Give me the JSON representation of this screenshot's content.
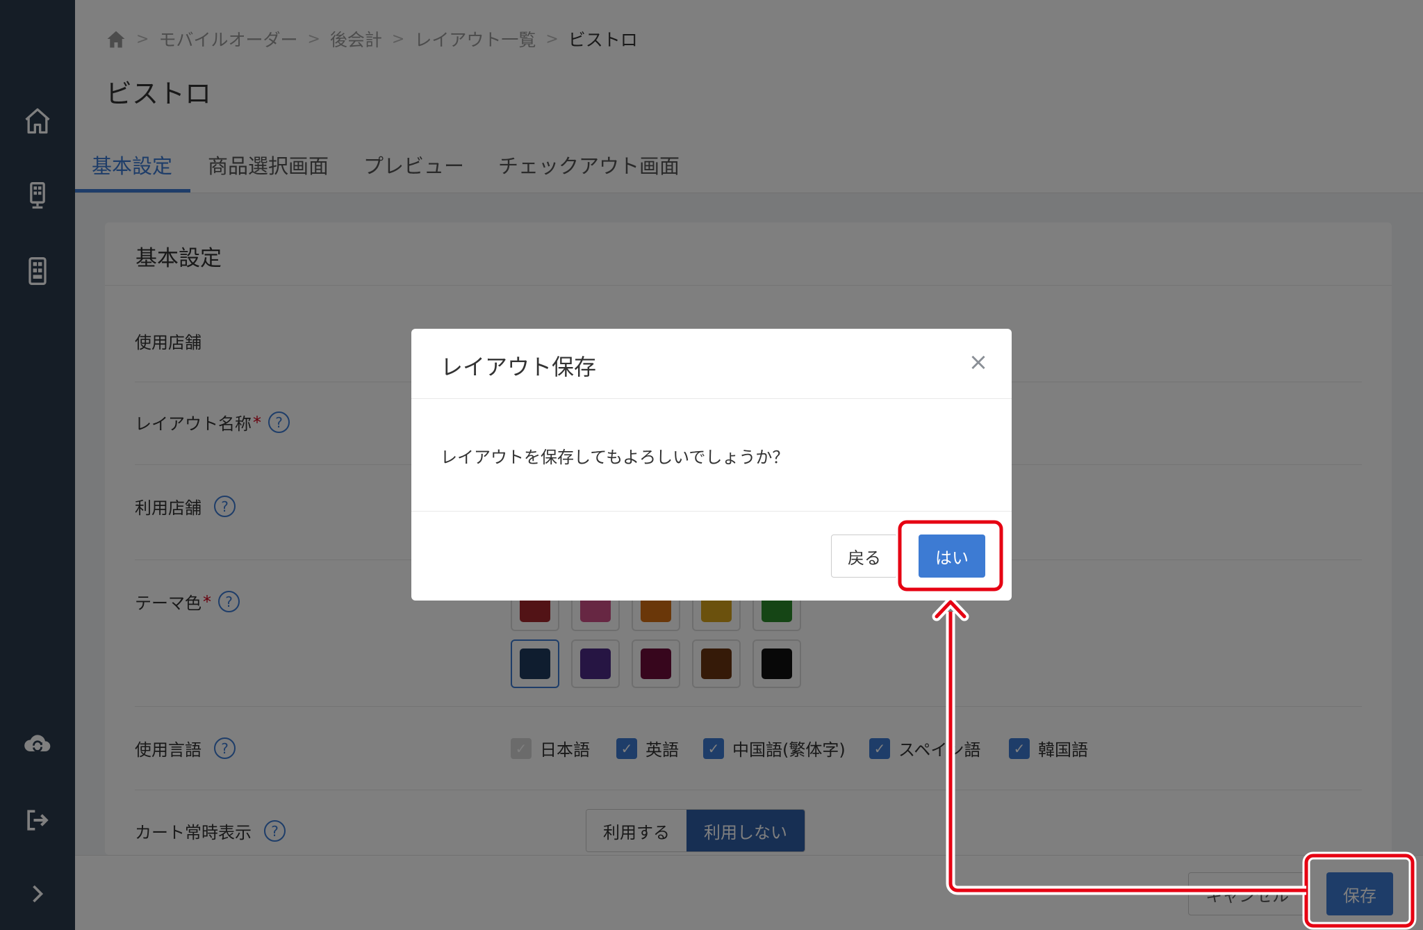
{
  "breadcrumb": {
    "items": [
      "モバイルオーダー",
      "後会計",
      "レイアウト一覧"
    ],
    "current": "ビストロ"
  },
  "page_title": "ビストロ",
  "tabs": [
    "基本設定",
    "商品選択画面",
    "プレビュー",
    "チェックアウト画面"
  ],
  "card": {
    "title": "基本設定",
    "rows": {
      "store_used": "使用店舗",
      "layout_name": "レイアウト名称",
      "store_using": "利用店舗",
      "theme_color": "テーマ色",
      "language": "使用言語",
      "cart_always": "カート常時表示"
    },
    "help_glyph": "?",
    "required_mark": "*"
  },
  "theme_colors": {
    "top_row": [
      "#a4262c",
      "#cf4f86",
      "#d56f12",
      "#d6a31a",
      "#2a8a2a"
    ],
    "bottom_row": [
      "#1f3a5f",
      "#4c2a86",
      "#6e0c3a",
      "#6b3510",
      "#111111"
    ],
    "selected": "#1f3a5f"
  },
  "languages": [
    {
      "label": "日本語",
      "checked": true,
      "disabled": true
    },
    {
      "label": "英語",
      "checked": true,
      "disabled": false
    },
    {
      "label": "中国語(繁体字)",
      "checked": true,
      "disabled": false
    },
    {
      "label": "スペイン語",
      "checked": true,
      "disabled": false
    },
    {
      "label": "韓国語",
      "checked": true,
      "disabled": false
    }
  ],
  "cart_toggle": {
    "use": "利用する",
    "not_use": "利用しない",
    "selected": "利用しない"
  },
  "footer": {
    "cancel": "キャンセル",
    "save": "保存"
  },
  "modal": {
    "title": "レイアウト保存",
    "body": "レイアウトを保存してもよろしいでしょうか？",
    "back": "戻る",
    "yes": "はい",
    "close_glyph": "×"
  },
  "colors": {
    "sidebar": "#2b3a4d",
    "accent": "#3d7bd3",
    "annotation": "#e60012"
  }
}
